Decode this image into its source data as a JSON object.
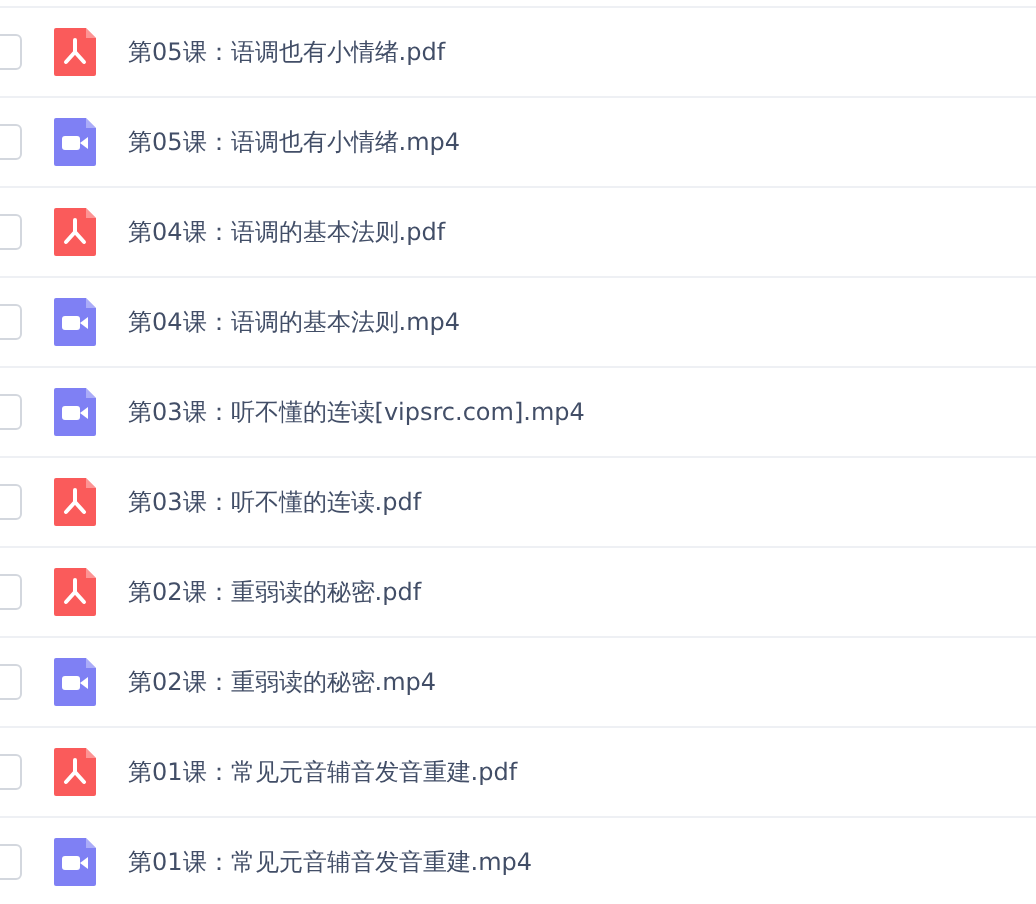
{
  "files": [
    {
      "kind": "pdf",
      "name": "第05课：语调也有小情绪.pdf",
      "checked": false
    },
    {
      "kind": "video",
      "name": "第05课：语调也有小情绪.mp4",
      "checked": false
    },
    {
      "kind": "pdf",
      "name": "第04课：语调的基本法则.pdf",
      "checked": false
    },
    {
      "kind": "video",
      "name": "第04课：语调的基本法则.mp4",
      "checked": false
    },
    {
      "kind": "video",
      "name": "第03课：听不懂的连读[vipsrc.com].mp4",
      "checked": false
    },
    {
      "kind": "pdf",
      "name": "第03课：听不懂的连读.pdf",
      "checked": false
    },
    {
      "kind": "pdf",
      "name": "第02课：重弱读的秘密.pdf",
      "checked": false
    },
    {
      "kind": "video",
      "name": "第02课：重弱读的秘密.mp4",
      "checked": false
    },
    {
      "kind": "pdf",
      "name": "第01课：常见元音辅音发音重建.pdf",
      "checked": false
    },
    {
      "kind": "video",
      "name": "第01课：常见元音辅音发音重建.mp4",
      "checked": false
    }
  ]
}
